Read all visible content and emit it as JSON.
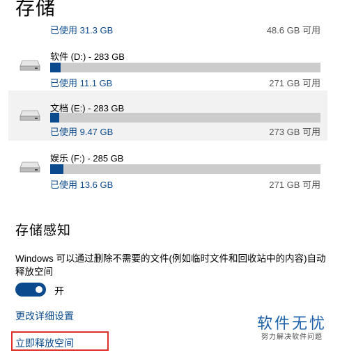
{
  "page": {
    "title": "存储"
  },
  "drive_top": {
    "used": "已使用 31.3 GB",
    "free": "48.6 GB 可用"
  },
  "drives": [
    {
      "name": "软件 (D:) - 283 GB",
      "used": "已使用 11.1 GB",
      "free": "271 GB 可用",
      "used_fraction": 0.039
    },
    {
      "name": "文档 (E:) - 283 GB",
      "used": "已使用 9.47 GB",
      "free": "273 GB 可用",
      "used_fraction": 0.033
    },
    {
      "name": "娱乐 (F:) - 285 GB",
      "used": "已使用 13.6 GB",
      "free": "271 GB 可用",
      "used_fraction": 0.048
    }
  ],
  "storage_sense": {
    "title": "存储感知",
    "description": "Windows 可以通过删除不需要的文件(例如临时文件和回收站中的内容)自动释放空间",
    "toggle_state_label": "开",
    "toggle_on": true,
    "change_settings_link": "更改详细设置",
    "free_up_now_link": "立即释放空间"
  },
  "watermark": {
    "main": "软件无忧",
    "sub": "努力解决软件问题"
  },
  "colors": {
    "accent": "#0b4a8c",
    "bar_bg": "#cccccc",
    "highlight": "#e0302a",
    "watermark": "#1a5fa8"
  }
}
